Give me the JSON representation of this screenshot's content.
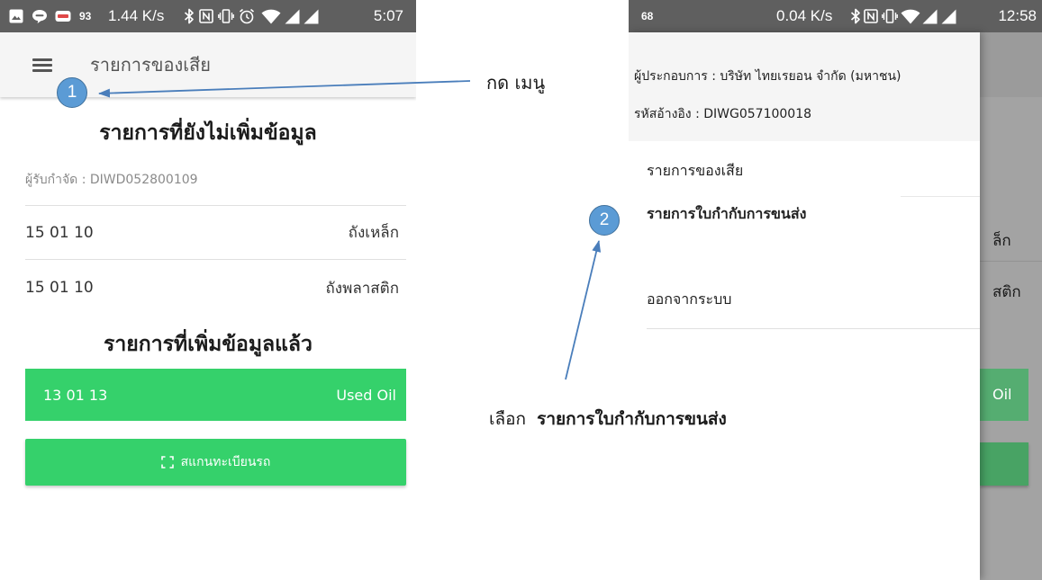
{
  "colors": {
    "status_bar": "#5f5f5f",
    "app_bar": "#f5f5f5",
    "accent_green": "#35d16b",
    "annotation_blue": "#5b9bd5",
    "arrow_blue": "#4a7ebb",
    "scrim": "#a3a3a3"
  },
  "left_phone": {
    "status_bar": {
      "icons": [
        "image-icon",
        "line-app-icon",
        "app-notification-icon",
        "bluetooth-icon",
        "nfc-icon",
        "vibrate-icon",
        "alarm-icon",
        "wifi-icon",
        "signal-icon",
        "signal-icon"
      ],
      "indicator": "93",
      "network_speed": "1.44 K/s",
      "time": "5:07"
    },
    "app_bar": {
      "menu_icon": "hamburger-menu-icon",
      "title": "รายการของเสีย"
    },
    "pending_section": {
      "heading": "รายการที่ยังไม่เพิ่มข้อมูล",
      "receiver": "ผู้รับกำจัด : DIWD052800109",
      "items": [
        {
          "code": "15 01 10",
          "name": "ถังเหล็ก"
        },
        {
          "code": "15 01 10",
          "name": "ถังพลาสติก"
        }
      ]
    },
    "completed_section": {
      "heading": "รายการที่เพิ่มข้อมูลแล้ว",
      "items": [
        {
          "code": "13 01 13",
          "name": "Used Oil"
        }
      ]
    },
    "scan_button": {
      "icon": "scan-icon",
      "label": "สแกนทะเบียนรถ"
    }
  },
  "right_phone": {
    "status_bar": {
      "icons": [
        "bluetooth-icon",
        "nfc-icon",
        "vibrate-icon",
        "wifi-icon",
        "signal-icon",
        "signal-icon"
      ],
      "indicator": "68",
      "network_speed": "0.04 K/s",
      "time": "12:58"
    },
    "drawer": {
      "operator": "ผู้ประกอบการ : บริษัท ไทยเรยอน จำกัด (มหาชน)",
      "reference": "รหัสอ้างอิง : DIWG057100018",
      "items": [
        {
          "label": "รายการของเสีย"
        },
        {
          "label": "รายการใบกำกับการขนส่ง"
        },
        {
          "label": "ออกจากระบบ"
        }
      ]
    },
    "dimmed_content": {
      "row_1_fragment": "ล็ก",
      "row_2_fragment": "สติก",
      "completed_fragment": "Oil"
    }
  },
  "annotations": {
    "step_1": {
      "number": "1",
      "text": "กด เมนู"
    },
    "step_2": {
      "number": "2",
      "prefix": "เลือก",
      "highlight": "รายการใบกำกับการขนส่ง"
    }
  }
}
